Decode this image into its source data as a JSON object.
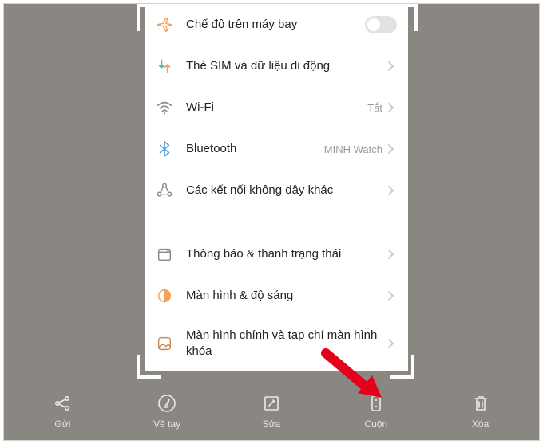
{
  "settings": {
    "items": [
      {
        "icon": "airplane-icon",
        "label": "Chế độ trên máy bay",
        "value": "",
        "control": "toggle",
        "chevron": false
      },
      {
        "icon": "sim-icon",
        "label": "Thẻ SIM và dữ liệu di động",
        "value": "",
        "control": "none",
        "chevron": true
      },
      {
        "icon": "wifi-icon",
        "label": "Wi-Fi",
        "value": "Tắt",
        "control": "none",
        "chevron": true
      },
      {
        "icon": "bluetooth-icon",
        "label": "Bluetooth",
        "value": "MINH Watch",
        "control": "none",
        "chevron": true
      },
      {
        "icon": "wireless-icon",
        "label": "Các kết nối không dây khác",
        "value": "",
        "control": "none",
        "chevron": true
      },
      {
        "icon": "notification-icon",
        "label": "Thông báo & thanh trạng thái",
        "value": "",
        "control": "none",
        "chevron": true
      },
      {
        "icon": "display-icon",
        "label": "Màn hình & độ sáng",
        "value": "",
        "control": "none",
        "chevron": true
      },
      {
        "icon": "home-lock-icon",
        "label": "Màn hình chính và tạp chí màn hình khóa",
        "value": "",
        "control": "none",
        "chevron": true
      }
    ]
  },
  "toolbar": {
    "items": [
      {
        "icon": "share-icon",
        "label": "Gửi"
      },
      {
        "icon": "draw-icon",
        "label": "Vẽ tay"
      },
      {
        "icon": "edit-icon",
        "label": "Sửa"
      },
      {
        "icon": "scroll-icon",
        "label": "Cuộn"
      },
      {
        "icon": "delete-icon",
        "label": "Xóa"
      }
    ]
  },
  "colors": {
    "accent_orange": "#f5a05b",
    "accent_green": "#3cc786",
    "accent_blue": "#5aa7e0",
    "accent_brown": "#c98a5a",
    "highlight_red": "#e4001b"
  }
}
